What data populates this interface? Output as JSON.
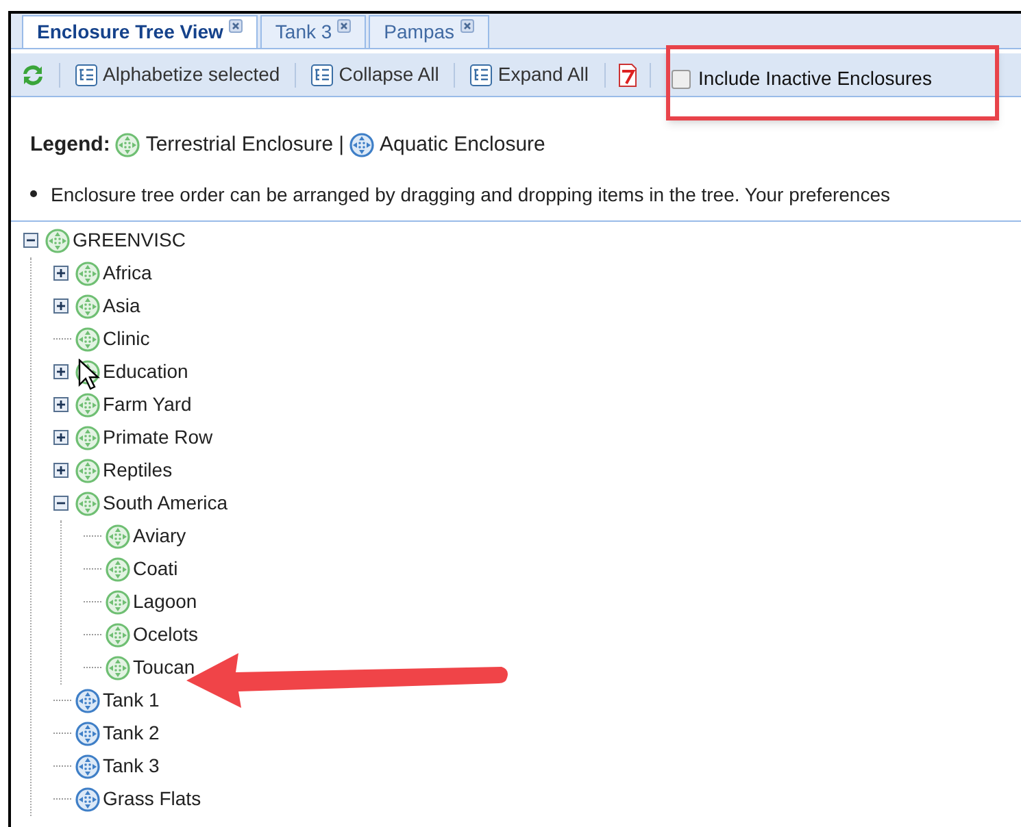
{
  "tabs": [
    {
      "label": "Enclosure Tree View",
      "selected": true
    },
    {
      "label": "Tank 3",
      "selected": false
    },
    {
      "label": "Pampas",
      "selected": false
    }
  ],
  "toolbar": {
    "buttons": [
      "Alphabetize selected",
      "Collapse All",
      "Expand All"
    ],
    "checkbox": {
      "label": "Include Inactive Enclosures",
      "checked": false
    }
  },
  "legend": {
    "title": "Legend:",
    "items": [
      {
        "kind": "terrestrial",
        "label": "Terrestrial Enclosure"
      },
      {
        "kind": "aquatic",
        "label": "Aquatic Enclosure"
      }
    ],
    "separator": "|"
  },
  "notes": [
    "Enclosure tree order can be arranged by dragging and dropping items in the tree. Your preferences"
  ],
  "tree": [
    {
      "label": "GREENVISC",
      "kind": "terrestrial",
      "expanded": true,
      "children": [
        {
          "label": "Africa",
          "kind": "terrestrial",
          "expanded": false
        },
        {
          "label": "Asia",
          "kind": "terrestrial",
          "expanded": false
        },
        {
          "label": "Clinic",
          "kind": "terrestrial"
        },
        {
          "label": "Education",
          "kind": "terrestrial",
          "expanded": false
        },
        {
          "label": "Farm Yard",
          "kind": "terrestrial",
          "expanded": false
        },
        {
          "label": "Primate Row",
          "kind": "terrestrial",
          "expanded": false
        },
        {
          "label": "Reptiles",
          "kind": "terrestrial",
          "expanded": false
        },
        {
          "label": "South America",
          "kind": "terrestrial",
          "expanded": true,
          "children": [
            {
              "label": "Aviary",
              "kind": "terrestrial"
            },
            {
              "label": "Coati",
              "kind": "terrestrial"
            },
            {
              "label": "Lagoon",
              "kind": "terrestrial"
            },
            {
              "label": "Ocelots",
              "kind": "terrestrial"
            },
            {
              "label": "Toucan",
              "kind": "terrestrial"
            }
          ]
        },
        {
          "label": "Tank 1",
          "kind": "aquatic"
        },
        {
          "label": "Tank 2",
          "kind": "aquatic"
        },
        {
          "label": "Tank 3",
          "kind": "aquatic"
        },
        {
          "label": "Grass Flats",
          "kind": "aquatic"
        }
      ]
    }
  ]
}
